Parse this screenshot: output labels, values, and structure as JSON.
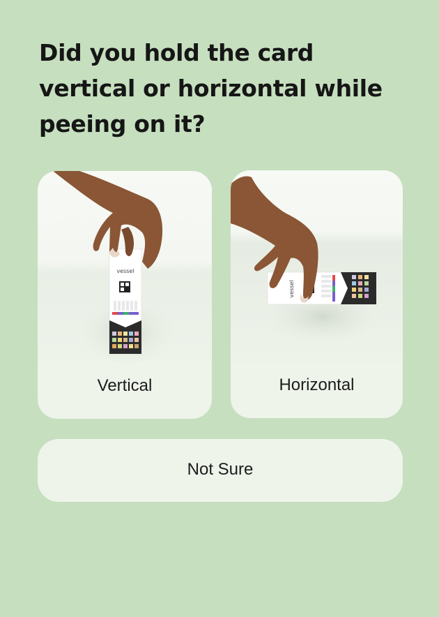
{
  "question": "Did you hold the card vertical or horizontal while peeing on it?",
  "options": [
    {
      "label": "Vertical",
      "image_caption": "vessel"
    },
    {
      "label": "Horizontal",
      "image_caption": "vessel"
    }
  ],
  "not_sure_label": "Not Sure"
}
